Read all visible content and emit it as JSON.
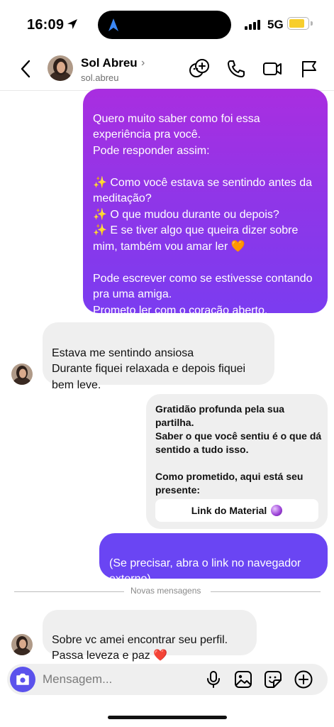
{
  "status_bar": {
    "time": "16:09",
    "network": "5G",
    "battery_level": 0.85,
    "icons": [
      "location-arrow-icon",
      "navigation-icon",
      "signal-icon",
      "battery-icon"
    ]
  },
  "header": {
    "contact_name": "Sol Abreu",
    "name_chevron": "›",
    "contact_handle": "sol.abreu",
    "icons": [
      "back-icon",
      "add-people-icon",
      "phone-icon",
      "video-icon",
      "flag-icon"
    ]
  },
  "messages": [
    {
      "type": "sent",
      "text": "Quero muito saber como foi essa experiência pra você.\nPode responder assim:\n\n✨ Como você estava se sentindo antes da meditação?\n✨ O que mudou durante ou depois?\n✨ E se tiver algo que queira dizer sobre mim, também vou amar ler 🧡\n\nPode escrever como se estivesse contando pra uma amiga.\nPrometo ler com o coração aberto."
    },
    {
      "type": "received",
      "text": "Estava me sentindo ansiosa\nDurante fiquei relaxada e depois fiquei bem leve."
    },
    {
      "type": "card",
      "text": "Gratidão profunda pela sua partilha.\nSaber o que você sentiu é o que dá sentido a tudo isso.\n\nComo prometido, aqui está seu presente:",
      "link_label": "Link do Material",
      "link_icon": "crystal-ball-icon"
    },
    {
      "type": "sent",
      "text": "(Se precisar, abra o link no navegador externo)"
    },
    {
      "type": "received",
      "text": "Sobre vc amei encontrar seu perfil.\nPassa leveza e paz ❤️"
    }
  ],
  "divider_label": "Novas mensagens",
  "composer": {
    "placeholder": "Mensagem...",
    "icons": [
      "camera-icon",
      "microphone-icon",
      "gallery-icon",
      "sticker-icon",
      "plus-icon"
    ]
  },
  "colors": {
    "sent_gradient_top": "#a92ee0",
    "sent_gradient_bottom": "#7b3cf0",
    "sent_solid": "#6a45f3",
    "received_bg": "#efefef",
    "camera_button": "#5b52ec",
    "battery": "#f7ce2c"
  }
}
